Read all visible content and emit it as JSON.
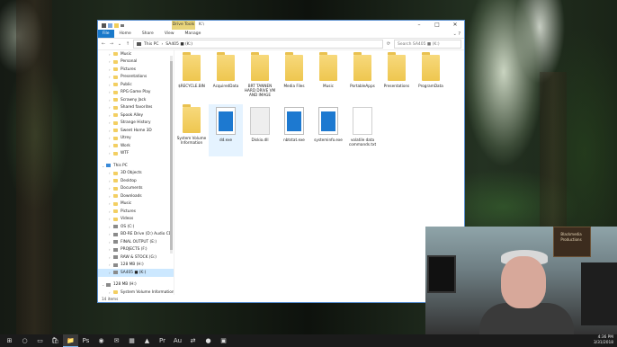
{
  "window": {
    "contextual_tab": "Drive Tools",
    "title": "K:\\",
    "controls": [
      "–",
      "□",
      "✕"
    ]
  },
  "ribbon": {
    "tabs": [
      "File",
      "Home",
      "Share",
      "View",
      "Manage"
    ]
  },
  "address": {
    "path": [
      "This PC",
      "SA405 ■ (K:)"
    ],
    "search_placeholder": "Search SA405 ■ (K:)"
  },
  "nav": {
    "items": [
      {
        "label": "Music",
        "type": "folder",
        "level": 1
      },
      {
        "label": "Personal",
        "type": "folder",
        "level": 1
      },
      {
        "label": "Pictures",
        "type": "folder",
        "level": 1
      },
      {
        "label": "Presentations",
        "type": "folder",
        "level": 1
      },
      {
        "label": "Public",
        "type": "folder",
        "level": 1
      },
      {
        "label": "RPG Game Play",
        "type": "folder",
        "level": 1
      },
      {
        "label": "Scrawny Jack",
        "type": "folder",
        "level": 1
      },
      {
        "label": "Shared favorites",
        "type": "folder",
        "level": 1
      },
      {
        "label": "Spook Alley",
        "type": "folder",
        "level": 1
      },
      {
        "label": "Strange History",
        "type": "folder",
        "level": 1
      },
      {
        "label": "Sweet Home 3D",
        "type": "folder",
        "level": 1
      },
      {
        "label": "Utrey",
        "type": "folder",
        "level": 1
      },
      {
        "label": "Work",
        "type": "folder",
        "level": 1
      },
      {
        "label": "WTF",
        "type": "folder",
        "level": 1
      },
      {
        "label": "",
        "type": "spacer",
        "level": 0
      },
      {
        "label": "This PC",
        "type": "pc",
        "level": 0
      },
      {
        "label": "3D Objects",
        "type": "folder",
        "level": 1
      },
      {
        "label": "Desktop",
        "type": "folder",
        "level": 1
      },
      {
        "label": "Documents",
        "type": "folder",
        "level": 1
      },
      {
        "label": "Downloads",
        "type": "folder",
        "level": 1
      },
      {
        "label": "Music",
        "type": "folder",
        "level": 1
      },
      {
        "label": "Pictures",
        "type": "folder",
        "level": 1
      },
      {
        "label": "Videos",
        "type": "folder",
        "level": 1
      },
      {
        "label": "OS (C:)",
        "type": "drive",
        "level": 1
      },
      {
        "label": "BD-RE Drive (D:) Audio CD",
        "type": "drive",
        "level": 1
      },
      {
        "label": "FINAL OUTPUT (E:)",
        "type": "drive",
        "level": 1
      },
      {
        "label": "PROJECTS (F:)",
        "type": "drive",
        "level": 1
      },
      {
        "label": "RAW & STOCK (G:)",
        "type": "drive",
        "level": 1
      },
      {
        "label": "128 MB (H:)",
        "type": "drive",
        "level": 1
      },
      {
        "label": "SA405 ■ (K:)",
        "type": "drive",
        "level": 1,
        "selected": true
      },
      {
        "label": "",
        "type": "spacer",
        "level": 0
      },
      {
        "label": "128 MB (H:)",
        "type": "drive",
        "level": 0
      },
      {
        "label": "System Volume Information",
        "type": "folder",
        "level": 1
      }
    ]
  },
  "files": [
    {
      "label": "$RECYCLE.BIN",
      "kind": "folder"
    },
    {
      "label": "AcquiredData",
      "kind": "folder"
    },
    {
      "label": "BRT TANNEN HARD DRIVE VM AND IMAGE",
      "kind": "folder"
    },
    {
      "label": "Media Files",
      "kind": "folder"
    },
    {
      "label": "Music",
      "kind": "folder"
    },
    {
      "label": "PortableApps",
      "kind": "folder"
    },
    {
      "label": "Presentations",
      "kind": "folder"
    },
    {
      "label": "ProgramData",
      "kind": "folder"
    },
    {
      "label": "System Volume Information",
      "kind": "folder"
    },
    {
      "label": "dd.exe",
      "kind": "exe",
      "highlight": true
    },
    {
      "label": "Diskio.dll",
      "kind": "dll"
    },
    {
      "label": "nbtstat.exe",
      "kind": "exe"
    },
    {
      "label": "systeminfo.exe",
      "kind": "exe"
    },
    {
      "label": "volatile data commands.txt",
      "kind": "txt"
    }
  ],
  "status": {
    "count": "14 items"
  },
  "webcam": {
    "sign": "Blackmedia Productions"
  },
  "taskbar": {
    "icons": [
      "windows-icon",
      "search-icon",
      "task-view-icon",
      "store-icon",
      "file-explorer-icon",
      "photoshop-icon",
      "chrome-icon",
      "mail-icon",
      "calculator-icon",
      "vlc-icon",
      "premiere-icon",
      "audition-icon",
      "teamviewer-icon",
      "obs-icon",
      "terminal-icon"
    ],
    "time": "4:36 PM",
    "date": "3/31/2018"
  }
}
